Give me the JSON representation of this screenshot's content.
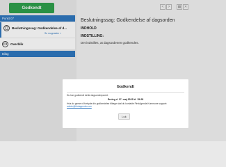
{
  "left": {
    "approve_button": "Godkendt",
    "section_item": "Punkt 07",
    "item1": {
      "label": "Beslutningssag: Godkendelse af d...",
      "sub": "Se mugnaden >"
    },
    "item2": {
      "label": "Overblik"
    },
    "section_bilag": "Bilag"
  },
  "toolbar": {
    "prev": "<",
    "next": ">",
    "grid": "▦",
    "close": "✕"
  },
  "doc": {
    "title": "Beslutningssag: Godkendelse af dagsorden",
    "heading1": "INDHOLD",
    "heading2": "INDSTILLING:",
    "paragraph": "Det indstilles, at dagsordenen godkendes."
  },
  "modal": {
    "title": "Godkendt",
    "text1": "Du har godkendt dette dagsordenpunkt.",
    "date": "Ersteg d. 17. maj 2022 kl. 15:28",
    "text2": "Hvis du gerne vil fortryde din godkendelse tilbage skal du kontakte FirstAgenda Kommune support:",
    "email": "admin@firstagenda.com",
    "close_label": "Luk"
  },
  "colors": {
    "approve_green": "#2fa04c",
    "section_blue": "#2f77bf"
  }
}
